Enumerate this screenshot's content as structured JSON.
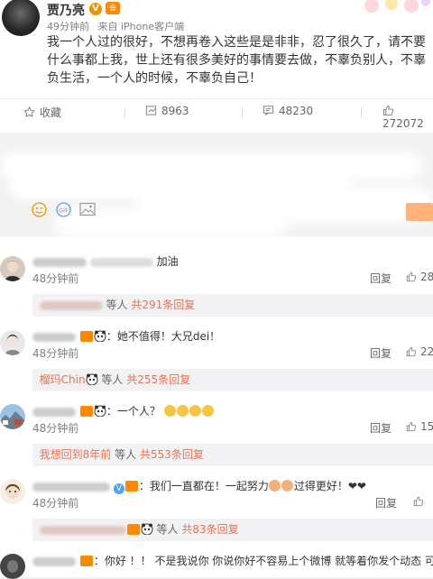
{
  "post": {
    "author": "贾乃亮",
    "time": "49分钟前",
    "source": "来自 iPhone客户端",
    "content": "我一个人过的很好，不想再卷入这些是是非非，忍了很久了，请不要什么事都上我，世上还有很多美好的事情要去做，不辜负别人，不辜负生活，一个人的时候，不辜负自己！"
  },
  "actions": {
    "favorite": "收藏",
    "repost": "8963",
    "comment": "48230",
    "like": "272072"
  },
  "comments": [
    {
      "name": "",
      "text": "加油",
      "time": "48分钟前",
      "reply": "回复",
      "likes": "28",
      "more_names": "",
      "more_suffix": "等人",
      "more_count": "共291条回复"
    },
    {
      "name": "",
      "text": "：她不值得！大兄dei！",
      "time": "48分钟前",
      "reply": "回复",
      "likes": "22",
      "more_names": "榴玛Chin",
      "more_suffix": "等人",
      "more_count": "共255条回复"
    },
    {
      "name": "",
      "text": "：一个人？",
      "time": "48分钟前",
      "reply": "回复",
      "likes": "15",
      "more_names": "我想回到8年前",
      "more_suffix": "等人",
      "more_count": "共553条回复"
    },
    {
      "name": "",
      "text": "：我们一直都在！一起努力",
      "text2": "过得更好！",
      "time": "48分钟前",
      "reply": "回复",
      "likes": "",
      "more_names": "",
      "more_suffix": "等人",
      "more_count": "共83条回复"
    },
    {
      "name": "",
      "text": "：你好 ！！ 不是我说你 你说你好不容易上个微博 就等着你发个动态 可"
    }
  ]
}
